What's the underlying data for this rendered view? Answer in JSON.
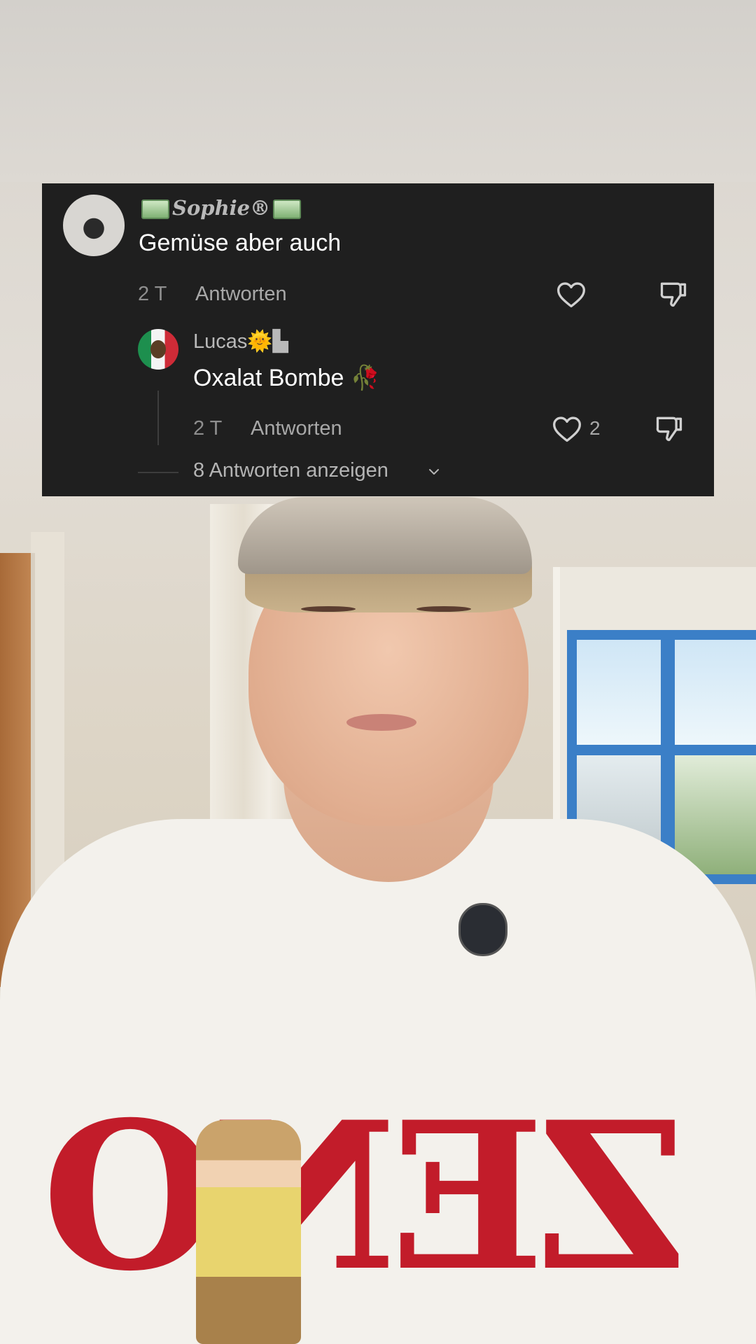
{
  "comments": [
    {
      "username": "Sophie®",
      "text": "Gemüse aber auch",
      "time": "2 T",
      "reply_label": "Antworten"
    },
    {
      "username": "Lucas🌞▙",
      "text": "Oxalat Bombe 🥀",
      "time": "2 T",
      "reply_label": "Antworten",
      "like_count": "2"
    }
  ],
  "view_replies_label": "8 Antworten anzeigen",
  "shirt_print": "ZENO",
  "colors": {
    "panel_background": "#1f1f1f",
    "print_red": "#c21c2a",
    "window_blue": "#3b7fc7"
  },
  "icons": [
    "heart-outline-icon",
    "thumbs-down-outline-icon",
    "chevron-down-icon",
    "money-badge-icon"
  ]
}
